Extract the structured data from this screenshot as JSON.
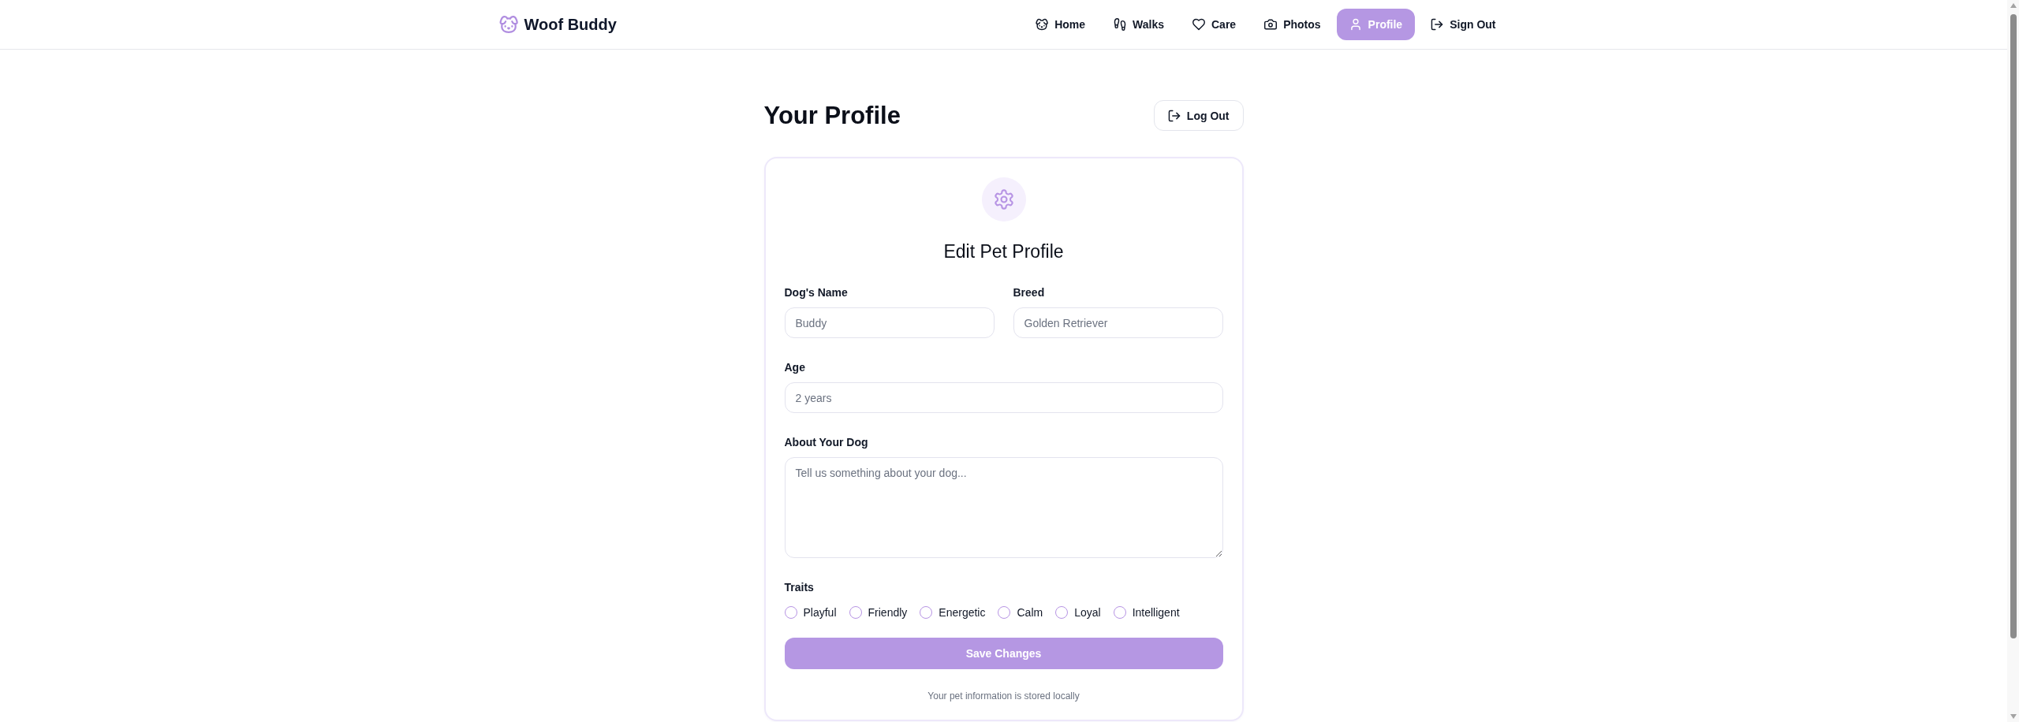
{
  "header": {
    "app_name": "Woof Buddy",
    "nav": [
      {
        "label": "Home",
        "selected": false
      },
      {
        "label": "Walks",
        "selected": false
      },
      {
        "label": "Care",
        "selected": false
      },
      {
        "label": "Photos",
        "selected": false
      },
      {
        "label": "Profile",
        "selected": true
      },
      {
        "label": "Sign Out",
        "selected": false
      }
    ]
  },
  "page": {
    "title": "Your Profile",
    "log_out_button": "Log Out"
  },
  "card": {
    "title": "Edit Pet Profile",
    "rows": [
      [
        {
          "kind": "input",
          "label": "Dog's Name",
          "placeholder": "Buddy"
        },
        {
          "kind": "input",
          "label": "Breed",
          "placeholder": "Golden Retriever"
        }
      ],
      [
        {
          "kind": "input",
          "label": "Age",
          "placeholder": "2 years"
        }
      ],
      [
        {
          "kind": "textarea",
          "label": "About Your Dog",
          "placeholder": "Tell us something about your dog..."
        }
      ]
    ],
    "traits": {
      "label": "Traits",
      "options": [
        {
          "label": "Playful",
          "checked": false
        },
        {
          "label": "Friendly",
          "checked": false
        },
        {
          "label": "Energetic",
          "checked": false
        },
        {
          "label": "Calm",
          "checked": false
        },
        {
          "label": "Loyal",
          "checked": false
        },
        {
          "label": "Intelligent",
          "checked": false
        }
      ]
    },
    "save_button": "Save Changes",
    "note": "Your pet information is stored locally"
  }
}
